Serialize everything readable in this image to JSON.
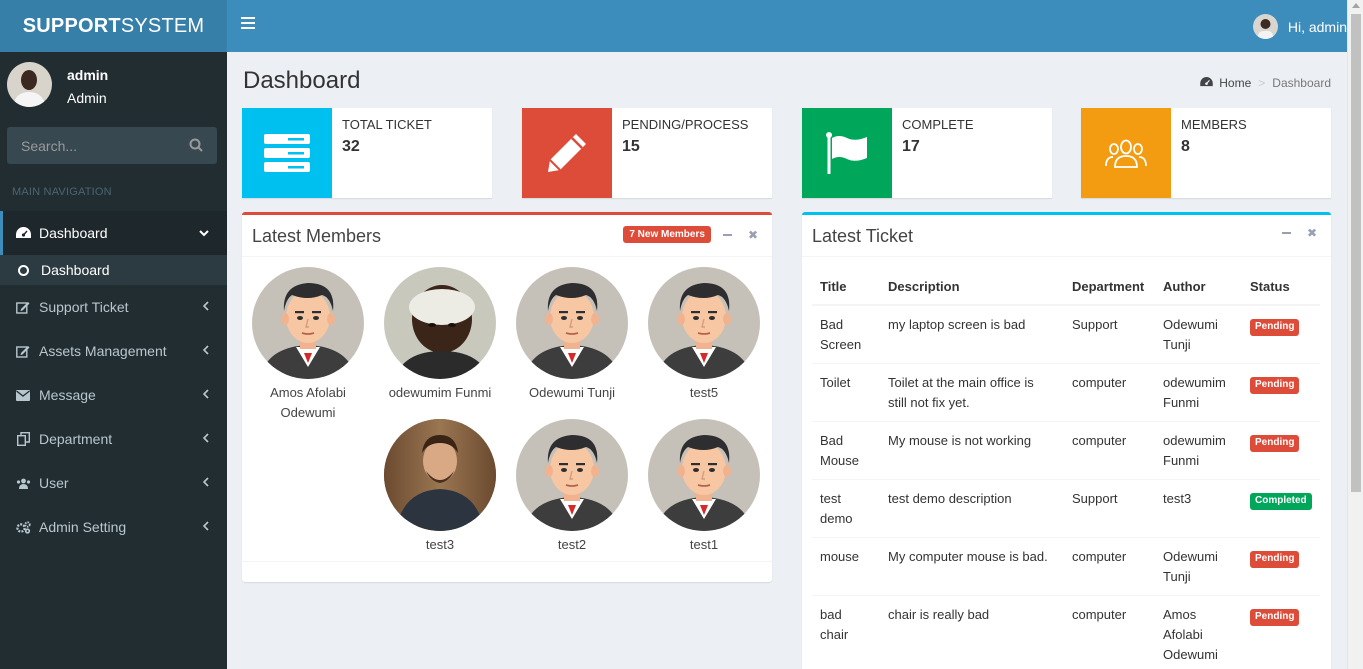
{
  "brand": {
    "bold": "SUPPORT",
    "light": "SYSTEM"
  },
  "header": {
    "greeting": "Hi, admin"
  },
  "sidebar": {
    "user_name": "admin",
    "user_role": "Admin",
    "search_placeholder": "Search...",
    "nav_header": "MAIN NAVIGATION",
    "items": [
      {
        "label": "Dashboard",
        "icon": "dashboard-icon"
      },
      {
        "label": "Dashboard",
        "icon": "circle-icon"
      },
      {
        "label": "Support Ticket",
        "icon": "edit-icon"
      },
      {
        "label": "Assets Management",
        "icon": "edit-icon"
      },
      {
        "label": "Message",
        "icon": "envelope-icon"
      },
      {
        "label": "Department",
        "icon": "copy-icon"
      },
      {
        "label": "User",
        "icon": "users-icon"
      },
      {
        "label": "Admin Setting",
        "icon": "cogs-icon"
      }
    ]
  },
  "page": {
    "title": "Dashboard"
  },
  "breadcrumb": {
    "home": "Home",
    "current": "Dashboard"
  },
  "stats": [
    {
      "label": "TOTAL TICKET",
      "value": "32",
      "color": "#00c0ef",
      "icon": "server-icon"
    },
    {
      "label": "PENDING/PROCESS",
      "value": "15",
      "color": "#dd4b39",
      "icon": "pencil-icon"
    },
    {
      "label": "COMPLETE",
      "value": "17",
      "color": "#00a65a",
      "icon": "flag-icon"
    },
    {
      "label": "MEMBERS",
      "value": "8",
      "color": "#f39c12",
      "icon": "users-icon"
    }
  ],
  "latest_members": {
    "title": "Latest Members",
    "badge": "7 New Members",
    "members": [
      {
        "name": "Amos Afolabi Odewumi"
      },
      {
        "name": "odewumim Funmi"
      },
      {
        "name": "Odewumi Tunji"
      },
      {
        "name": "test5"
      },
      {
        "name": "test3"
      },
      {
        "name": "test2"
      },
      {
        "name": "test1"
      }
    ]
  },
  "latest_ticket": {
    "title": "Latest Ticket",
    "columns": [
      "Title",
      "Description",
      "Department",
      "Author",
      "Status"
    ],
    "rows": [
      {
        "title": "Bad Screen",
        "description": "my laptop screen is bad",
        "department": "Support",
        "author": "Odewumi Tunji",
        "status": "Pending"
      },
      {
        "title": "Toilet",
        "description": "Toilet at the main office is still not fix yet.",
        "department": "computer",
        "author": "odewumim Funmi",
        "status": "Pending"
      },
      {
        "title": "Bad Mouse",
        "description": "My mouse is not working",
        "department": "computer",
        "author": "odewumim Funmi",
        "status": "Pending"
      },
      {
        "title": "test demo",
        "description": "test demo description",
        "department": "Support",
        "author": "test3",
        "status": "Completed"
      },
      {
        "title": "mouse",
        "description": "My computer mouse is bad.",
        "department": "computer",
        "author": "Odewumi Tunji",
        "status": "Pending"
      },
      {
        "title": "bad chair",
        "description": "chair is really bad",
        "department": "computer",
        "author": "Amos Afolabi Odewumi",
        "status": "Pending"
      }
    ]
  }
}
